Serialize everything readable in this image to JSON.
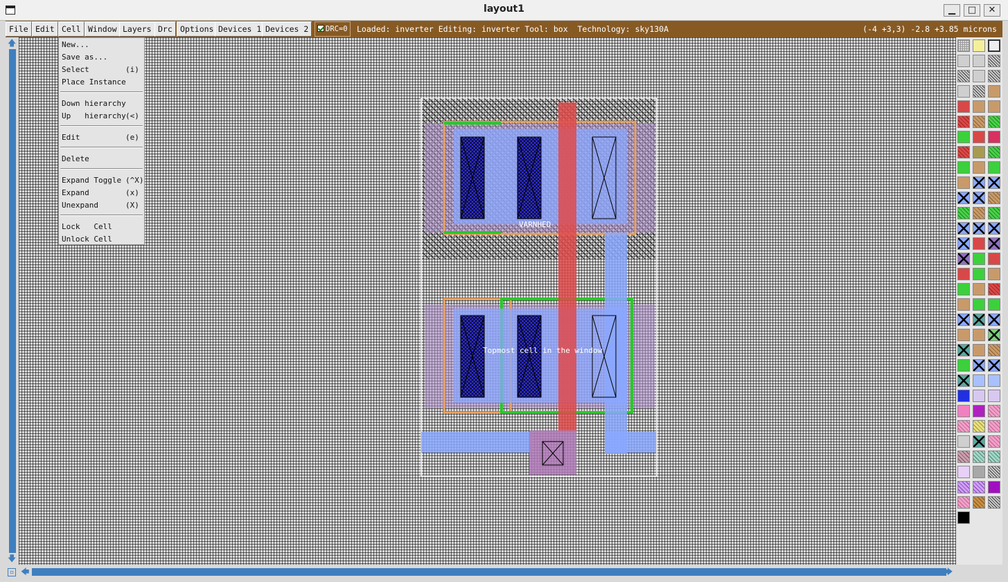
{
  "window": {
    "title": "layout1",
    "controls": {
      "minimize": "▁",
      "maximize": "□",
      "close": "✕"
    }
  },
  "menubar": {
    "items": [
      "File",
      "Edit",
      "Cell",
      "Window",
      "Layers",
      "Drc",
      "Options",
      "Devices 1",
      "Devices 2"
    ],
    "drc_label": "DRC=0",
    "status": "Loaded: inverter Editing: inverter Tool: box  Technology: sky130A",
    "coordinates": "(-4 +3,3) -2.8 +3.85 microns"
  },
  "cell_menu": {
    "groups": [
      [
        {
          "label": "New...",
          "accel": ""
        },
        {
          "label": "Save as...",
          "accel": ""
        },
        {
          "label": "Select",
          "accel": "(i)"
        },
        {
          "label": "Place Instance",
          "accel": ""
        }
      ],
      [
        {
          "label": "Down hierarchy",
          "accel": ""
        },
        {
          "label": "Up   hierarchy",
          "accel": "(<)"
        }
      ],
      [
        {
          "label": "Edit",
          "accel": "(e)"
        }
      ],
      [
        {
          "label": "Delete",
          "accel": ""
        }
      ],
      [
        {
          "label": "Expand Toggle",
          "accel": "(^X)"
        },
        {
          "label": "Expand",
          "accel": "(x)"
        },
        {
          "label": "Unexpand",
          "accel": "(X)"
        }
      ],
      [
        {
          "label": "Lock   Cell",
          "accel": ""
        },
        {
          "label": "Unlock Cell",
          "accel": ""
        }
      ]
    ]
  },
  "canvas": {
    "labels": {
      "upper": "VARNHED",
      "center": "Topmost cell in the window"
    }
  },
  "colors": {
    "menubar_bg": "#875a24",
    "scrollbar": "#3f7fbf",
    "poly": "#e04a4a",
    "diff": "#28c828",
    "metal": "#8aa8ff",
    "contact": "#2020d0",
    "well": "#b090d0"
  },
  "palette": {
    "swatches": [
      "grid",
      "yellow",
      "outline",
      "lgray",
      "lgray",
      "hatch",
      "hatch",
      "lgray",
      "hatch",
      "lgray",
      "hatch",
      "tan",
      "red",
      "tan",
      "tan",
      "redh",
      "tanh",
      "greenh",
      "green",
      "red",
      "crimson",
      "redh",
      "olive",
      "greenh",
      "green",
      "tan",
      "green",
      "tan",
      "xblue",
      "xblue",
      "xblue",
      "xblue",
      "tanh",
      "greenh",
      "tanh",
      "greenh",
      "xblue",
      "xblue",
      "xblue",
      "xblue",
      "red",
      "xpurple",
      "xpurple",
      "green",
      "red",
      "red",
      "green",
      "tan",
      "green",
      "tan",
      "redh",
      "tan",
      "green",
      "green",
      "xblue",
      "xteal",
      "xblue",
      "tan",
      "tan",
      "xgreen",
      "xteal",
      "tan",
      "tanh",
      "green",
      "xblue",
      "xblue",
      "xteal",
      "lblue",
      "lblue",
      "dblue",
      "lilac",
      "lilac",
      "pink",
      "magenta",
      "pinkh",
      "pinkh",
      "yellowh",
      "pinkh",
      "lgray",
      "xteal",
      "pinkh",
      "mauveh",
      "tealh",
      "tealh",
      "violet",
      "gray",
      "hatch",
      "violeth",
      "violeth",
      "purple",
      "pinkh",
      "orangeh",
      "hatch",
      "black"
    ]
  }
}
